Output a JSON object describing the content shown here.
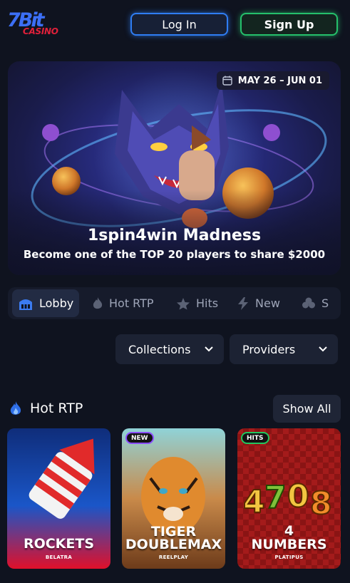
{
  "header": {
    "logo_mark": "7Bit",
    "logo_sub": "CASINO",
    "login_label": "Log In",
    "signup_label": "Sign Up"
  },
  "banner": {
    "date_range": "MAY 26 – JUN 01",
    "title": "1spin4win Madness",
    "subtitle": "Become one of the TOP 20 players to share $2000"
  },
  "tabs": [
    {
      "label": "Lobby",
      "icon": "lobby-icon",
      "active": true
    },
    {
      "label": "Hot RTP",
      "icon": "flame-icon",
      "active": false
    },
    {
      "label": "Hits",
      "icon": "stars-icon",
      "active": false
    },
    {
      "label": "New",
      "icon": "lightning-icon",
      "active": false
    },
    {
      "label": "S",
      "icon": "clover-icon",
      "active": false
    }
  ],
  "filters": {
    "collections_label": "Collections",
    "providers_label": "Providers"
  },
  "section": {
    "title": "Hot RTP",
    "show_all_label": "Show All"
  },
  "games": [
    {
      "title_line1": "ROCKETS",
      "title_line2": "",
      "provider": "BELATRA",
      "badge": ""
    },
    {
      "title_line1": "TIGER",
      "title_line2": "DOUBLEMAX",
      "provider": "REELPLAY",
      "badge": "NEW"
    },
    {
      "title_line1": "4",
      "title_line2": "NUMBERS",
      "provider": "PLATIPUS",
      "badge": "HITS"
    }
  ],
  "colors": {
    "background": "#0f131f",
    "login_border": "#2f7df3",
    "signup_border": "#25c06b",
    "new_badge": "#8a4dff",
    "hits_badge": "#22c55e"
  }
}
